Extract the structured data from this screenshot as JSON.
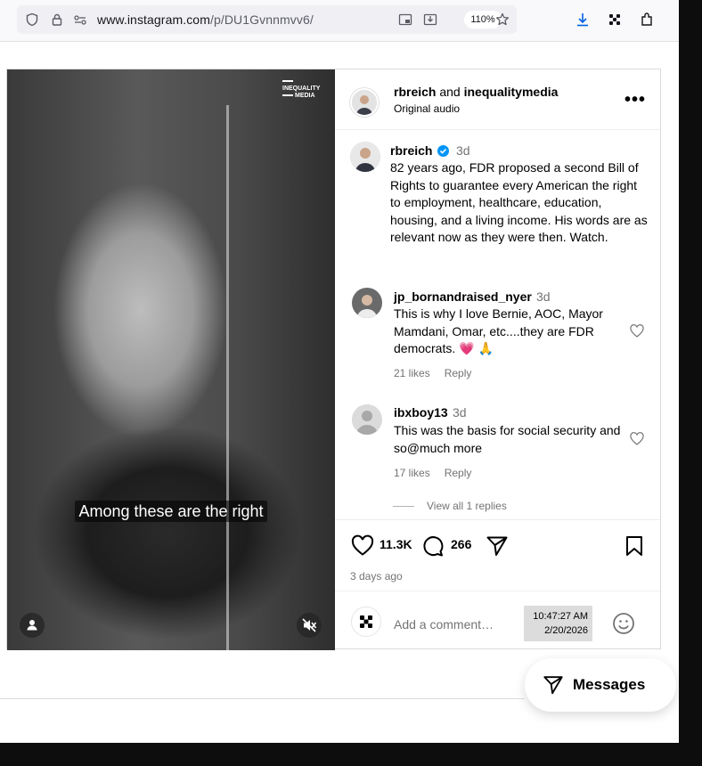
{
  "browser": {
    "url_host": "www.instagram.com",
    "url_path": "/p/DU1Gvnnmvv6/",
    "zoom": "110%"
  },
  "video": {
    "watermark_line1": "INEQUALITY",
    "watermark_line2": "MEDIA",
    "subtitle": "Among these are the right"
  },
  "post": {
    "header": {
      "author": "rbreich",
      "and_text": "and",
      "collaborator": "inequalitymedia",
      "audio": "Original audio"
    },
    "caption": {
      "username": "rbreich",
      "time": "3d",
      "text": "82 years ago, FDR proposed a second Bill of Rights to guarantee every American the right to employment, healthcare, education, housing, and a living income. His words are as relevant now as they were then. Watch."
    },
    "comments": [
      {
        "username": "jp_bornandraised_nyer",
        "time": "3d",
        "text": "This is why I love Bernie, AOC, Mayor Mamdani, Omar, etc....they are FDR democrats. 💗 🙏",
        "likes": "21 likes",
        "reply": "Reply"
      },
      {
        "username": "ibxboy13",
        "time": "3d",
        "text": "This was the basis for social security and so@much more",
        "likes": "17 likes",
        "reply": "Reply"
      }
    ],
    "view_replies": "View all 1 replies",
    "likes_count": "11.3K",
    "comments_count": "266",
    "posted": "3 days ago",
    "comment_placeholder": "Add a comment…"
  },
  "taskbar_clock": {
    "time": "10:47:27 AM",
    "date": "2/20/2026"
  },
  "messages_button": "Messages"
}
